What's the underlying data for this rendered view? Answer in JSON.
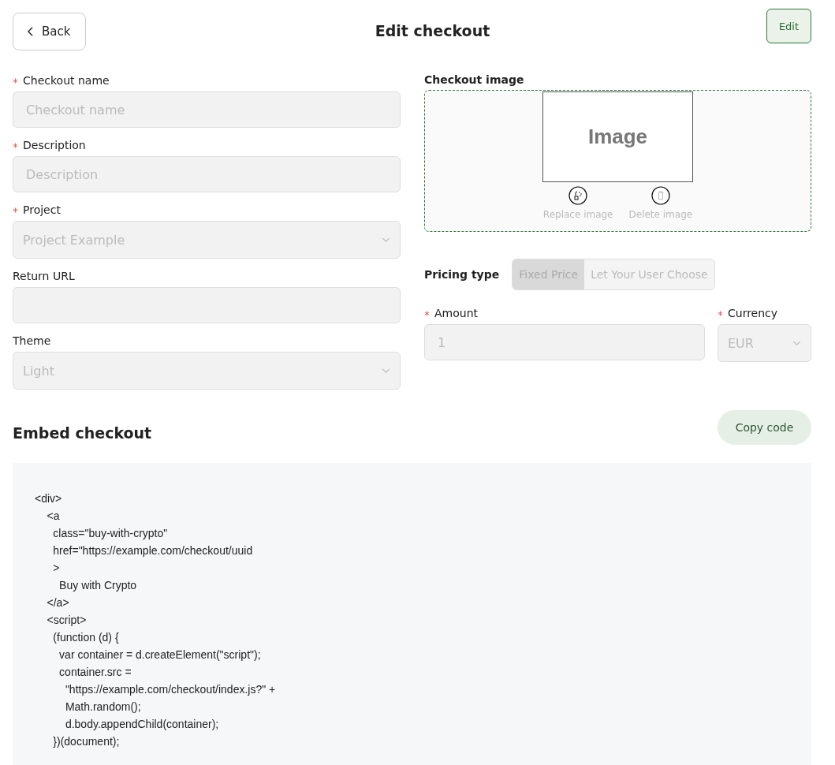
{
  "header": {
    "back_label": "Back",
    "title": "Edit checkout",
    "edit_label": "Edit"
  },
  "form_fields": [
    {
      "label": "Checkout name",
      "required": true,
      "kind": "input",
      "placeholder": "Checkout name",
      "disabled": true
    },
    {
      "label": "Description",
      "required": true,
      "kind": "input",
      "placeholder": "Description",
      "disabled": true
    },
    {
      "label": "Project",
      "required": true,
      "kind": "select",
      "value": "Project Example",
      "disabled": true
    },
    {
      "label": "Return URL",
      "required": false,
      "kind": "input",
      "disabled": true
    },
    {
      "label": "Theme",
      "required": false,
      "kind": "select",
      "value": "Light",
      "disabled": true
    }
  ],
  "checkout_image": {
    "label": "Checkout image",
    "preview_text": "Image",
    "actions": [
      {
        "label": "Replace image",
        "kind": "replace",
        "disabled": true
      },
      {
        "label": "Delete image",
        "kind": "delete",
        "disabled": true
      }
    ]
  },
  "pricing_type": {
    "label": "Pricing type",
    "options": [
      {
        "label": "Fixed Price",
        "selected": true
      },
      {
        "label": "Let Your User Choose",
        "selected": false
      }
    ]
  },
  "price_fields": [
    {
      "label": "Amount",
      "required": true,
      "kind": "input",
      "value": "1",
      "disabled": true
    },
    {
      "label": "Currency",
      "required": true,
      "kind": "select",
      "value": "EUR",
      "disabled": true
    }
  ],
  "embed": {
    "title": "Embed checkout",
    "copy_label": "Copy code",
    "code_lines": [
      "<div>",
      "    <a",
      "      class=\"buy-with-crypto\"",
      "      href=\"https://example.com/checkout/uuid",
      "      >",
      "        Buy with Crypto",
      "    </a>",
      "    <script>",
      "      (function (d) {",
      "        var container = d.createElement(\"script\");",
      "        container.src =",
      "          \"https://example.com/checkout/index.js?\" +",
      "          Math.random();",
      "          d.body.appendChild(container);",
      "      })(document);"
    ]
  }
}
